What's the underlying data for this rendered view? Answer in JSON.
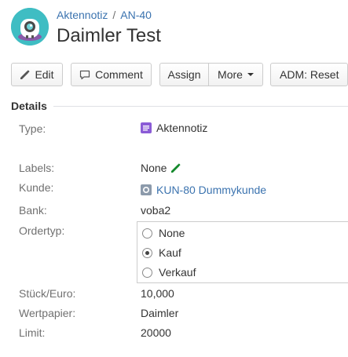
{
  "breadcrumb": {
    "project": "Aktennotiz",
    "separator": "/",
    "issue_key": "AN-40"
  },
  "title": "Daimler Test",
  "toolbar": {
    "edit": "Edit",
    "comment": "Comment",
    "assign": "Assign",
    "more": "More",
    "adm_reset": "ADM: Reset"
  },
  "details": {
    "heading": "Details",
    "type_label": "Type:",
    "type_value": "Aktennotiz",
    "labels_label": "Labels:",
    "labels_value": "None",
    "kunde_label": "Kunde:",
    "kunde_value": "KUN-80 Dummykunde",
    "bank_label": "Bank:",
    "bank_value": "voba2",
    "ordertyp_label": "Ordertyp:",
    "ordertyp_options": [
      "None",
      "Kauf",
      "Verkauf"
    ],
    "ordertyp_selected": "Kauf",
    "stueck_label": "Stück/Euro:",
    "stueck_value": "10,000",
    "wertpapier_label": "Wertpapier:",
    "wertpapier_value": "Daimler",
    "limit_label": "Limit:",
    "limit_value": "20000"
  },
  "colors": {
    "link": "#3b73af",
    "avatar": "#3fbdc3",
    "type_icon": "#8b5cd6",
    "pencil_green": "#14892c"
  },
  "icons": {
    "avatar": "monster-avatar-icon",
    "edit": "pencil-icon",
    "comment": "speech-bubble-icon",
    "type": "note-icon",
    "labels_edit": "pencil-icon",
    "kunde": "issue-icon"
  }
}
